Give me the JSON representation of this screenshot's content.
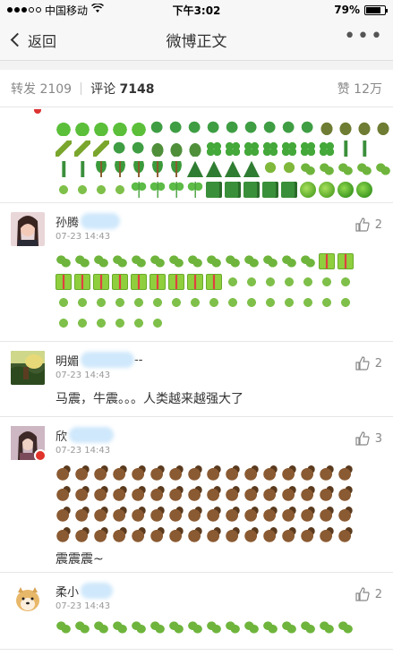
{
  "status": {
    "carrier": "中国移动",
    "time": "下午3:02",
    "battery": "79%",
    "battery_level": 0.79,
    "signal_dots_on": 3,
    "signal_dots_total": 5
  },
  "nav": {
    "back_label": "返回",
    "title": "微博正文",
    "more_label": "•••"
  },
  "tabs": {
    "repost": "转发 2109",
    "comment_label": "评论",
    "comment_count": "7148",
    "like": "赞 12万"
  },
  "comments": [
    {
      "name": "孙腾",
      "time": "07-23 14:43",
      "likes": "2",
      "emoji_rows": [
        [
          "herb",
          "herb",
          "herb",
          "herb",
          "herb",
          "herb",
          "herb",
          "herb",
          "herb",
          "herb",
          "herb",
          "herb",
          "herb",
          "herb",
          "gift",
          "gift"
        ],
        [
          "gift",
          "gift",
          "gift",
          "gift",
          "gift",
          "gift",
          "gift",
          "gift",
          "gift",
          "leaf",
          "leaf",
          "leaf",
          "leaf",
          "leaf",
          "leaf",
          "leaf"
        ],
        [
          "leaf",
          "leaf",
          "leaf",
          "leaf",
          "leaf",
          "leaf",
          "leaf",
          "leaf",
          "leaf",
          "leaf",
          "leaf",
          "leaf",
          "leaf",
          "leaf",
          "leaf",
          "leaf"
        ],
        [
          "leaf",
          "leaf",
          "leaf",
          "leaf",
          "leaf",
          "leaf"
        ]
      ]
    },
    {
      "name": "明媚",
      "name_suffix": "--",
      "time": "07-23 14:43",
      "likes": "2",
      "text": "马震，牛震。。。人类越来越强大了"
    },
    {
      "name": "欣",
      "time": "07-23 14:43",
      "likes": "3",
      "horse_rows": 4,
      "horse_per_row": 16,
      "text": "震震震~"
    },
    {
      "name": "柔小",
      "time": "07-23 14:43",
      "likes": "2",
      "emoji_rows": [
        [
          "herb",
          "herb",
          "herb",
          "herb",
          "herb",
          "herb",
          "herb",
          "herb",
          "herb",
          "herb",
          "herb",
          "herb",
          "herb",
          "herb",
          "herb",
          "herb"
        ]
      ]
    }
  ],
  "top_partial_rows": [
    [
      "frog",
      "frog",
      "frog",
      "frog",
      "frog",
      "snake",
      "snake",
      "snake",
      "snake",
      "snake",
      "snake",
      "snake",
      "snake",
      "snake",
      "turtle",
      "turtle",
      "turtle",
      "turtle"
    ],
    [
      "bamboo",
      "bamboo",
      "bamboo",
      "snake",
      "snake",
      "croc",
      "croc",
      "croc",
      "clover",
      "clover",
      "clover",
      "clover",
      "clover",
      "clover",
      "clover",
      "cactus",
      "cactus"
    ],
    [
      "cactus",
      "cactus",
      "palm",
      "palm",
      "palm",
      "palm",
      "palm",
      "pine",
      "pine",
      "pine",
      "pine",
      "tree",
      "tree",
      "herb",
      "herb",
      "herb",
      "herb",
      "herb"
    ],
    [
      "leaf",
      "leaf",
      "leaf",
      "leaf",
      "seedling",
      "seedling",
      "seedling",
      "seedling",
      "book",
      "book",
      "book",
      "book",
      "book",
      "melon",
      "melon",
      "apple",
      "apple"
    ]
  ]
}
